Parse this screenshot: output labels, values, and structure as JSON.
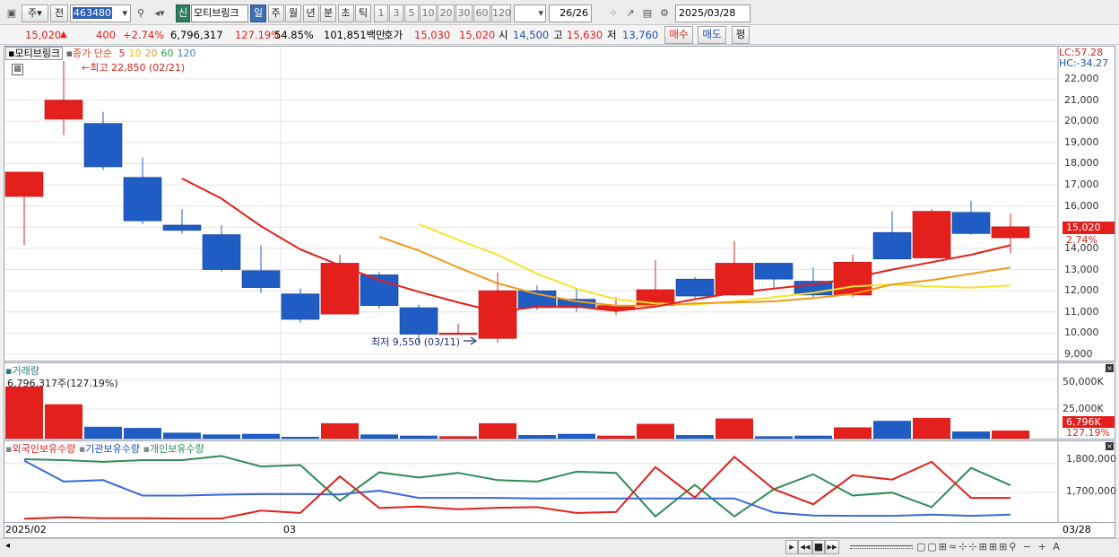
{
  "toolbar": {
    "type_label": "주",
    "prev_label": "전",
    "code": "463480",
    "stock_flag": "신",
    "stock_name": "모티브링크",
    "periods": [
      "일",
      "주",
      "월",
      "년",
      "분",
      "초",
      "틱"
    ],
    "active_period": "일",
    "intervals": [
      "1",
      "3",
      "5",
      "10",
      "20",
      "30",
      "60",
      "120"
    ],
    "count": "26/26",
    "date": "2025/03/28"
  },
  "quote": {
    "price": "15,020",
    "arrow": "▲",
    "change": "400",
    "change_pct": "+2.74%",
    "volume": "6,796,317",
    "volume_pct": "127.19%",
    "turnover_rate": "54.85%",
    "amount": "101,851백만",
    "bid_label": "호가",
    "bid1": "15,030",
    "bid2": "15,020",
    "open_label": "시",
    "open": "14,500",
    "high_label": "고",
    "high": "15,630",
    "low_label": "저",
    "low": "13,760",
    "buy_label": "매수",
    "sell_label": "매도",
    "eval_label": "평"
  },
  "price_panel": {
    "legend_name": "모티브링크",
    "legend_ma_label": "종가 단순",
    "ma_periods": [
      {
        "label": "5",
        "color": "#e3201b"
      },
      {
        "label": "10",
        "color": "#ffbf00"
      },
      {
        "label": "20",
        "color": "#f09a1a"
      },
      {
        "label": "60",
        "color": "#2ea043"
      },
      {
        "label": "120",
        "color": "#3b78d8"
      }
    ],
    "max_note": "←최고 22,850 (02/21)",
    "min_note": "최저 9,550 (03/11)",
    "lc": "LC:57.28",
    "hc": "HC:-34.27",
    "y_ticks": [
      "22,000",
      "21,000",
      "20,000",
      "19,000",
      "18,000",
      "17,000",
      "16,000",
      "15,000",
      "14,000",
      "13,000",
      "12,000",
      "11,000",
      "10,000",
      "9,000"
    ],
    "last_price": "15,020",
    "last_pct": "2.74%"
  },
  "volume_panel": {
    "title": "거래량",
    "value": "6,796,317주(127.19%)",
    "y_ticks": [
      "50,000K",
      "25,000K"
    ],
    "last_value": "6,796K",
    "last_pct": "127.19%"
  },
  "holding_panel": {
    "foreign_label": "외국인보유수량",
    "inst_label": "기관보유수량",
    "indiv_label": "개인보유수량",
    "y_ticks": [
      "1,800,000",
      "1,700,000"
    ]
  },
  "x_axis": {
    "start": "2025/02",
    "mid": "03",
    "end": "03/28"
  },
  "chart_data": {
    "type": "candlestick",
    "candles": [
      {
        "o": 16450,
        "h": 17600,
        "l": 14150,
        "c": 17600
      },
      {
        "o": 20100,
        "h": 22850,
        "l": 19350,
        "c": 21000
      },
      {
        "o": 19900,
        "h": 20450,
        "l": 17700,
        "c": 17850
      },
      {
        "o": 17350,
        "h": 18300,
        "l": 15150,
        "c": 15300
      },
      {
        "o": 15100,
        "h": 15850,
        "l": 14700,
        "c": 14850
      },
      {
        "o": 14650,
        "h": 15100,
        "l": 12900,
        "c": 13000
      },
      {
        "o": 12950,
        "h": 14150,
        "l": 11900,
        "c": 12150
      },
      {
        "o": 11850,
        "h": 12100,
        "l": 10500,
        "c": 10650
      },
      {
        "o": 10900,
        "h": 13700,
        "l": 10900,
        "c": 13300
      },
      {
        "o": 12750,
        "h": 12900,
        "l": 11150,
        "c": 11300
      },
      {
        "o": 11200,
        "h": 11350,
        "l": 9550,
        "c": 9950
      },
      {
        "o": 9950,
        "h": 10450,
        "l": 9950,
        "c": 10000
      },
      {
        "o": 9750,
        "h": 12850,
        "l": 9550,
        "c": 12000
      },
      {
        "o": 12000,
        "h": 12250,
        "l": 11100,
        "c": 11200
      },
      {
        "o": 11600,
        "h": 12100,
        "l": 11000,
        "c": 11200
      },
      {
        "o": 11100,
        "h": 11700,
        "l": 10850,
        "c": 11300
      },
      {
        "o": 11300,
        "h": 13450,
        "l": 11200,
        "c": 12050
      },
      {
        "o": 12550,
        "h": 12650,
        "l": 11650,
        "c": 11750
      },
      {
        "o": 11800,
        "h": 14350,
        "l": 11750,
        "c": 13300
      },
      {
        "o": 13300,
        "h": 13300,
        "l": 12150,
        "c": 12550
      },
      {
        "o": 12450,
        "h": 13100,
        "l": 11700,
        "c": 11800
      },
      {
        "o": 11800,
        "h": 13700,
        "l": 11700,
        "c": 13350
      },
      {
        "o": 14750,
        "h": 15750,
        "l": 13500,
        "c": 13500
      },
      {
        "o": 13550,
        "h": 15850,
        "l": 13550,
        "c": 15750
      },
      {
        "o": 15700,
        "h": 16250,
        "l": 14650,
        "c": 14700
      },
      {
        "o": 14500,
        "h": 15630,
        "l": 13760,
        "c": 15020
      }
    ],
    "ma5": [
      null,
      null,
      null,
      null,
      17300,
      16350,
      15050,
      13950,
      13200,
      12500,
      11950,
      11450,
      11000,
      11250,
      11250,
      11050,
      11250,
      11600,
      11900,
      12100,
      12300,
      12600,
      13000,
      13350,
      13700,
      14150
    ],
    "ma10": [
      null,
      null,
      null,
      null,
      null,
      null,
      null,
      null,
      null,
      null,
      15150,
      14400,
      13700,
      12800,
      12100,
      11600,
      11400,
      11350,
      11500,
      11700,
      11900,
      12200,
      12300,
      12200,
      12150,
      12250
    ],
    "ma20": [
      null,
      null,
      null,
      null,
      null,
      null,
      null,
      null,
      null,
      14550,
      13900,
      13100,
      12350,
      11850,
      11500,
      11300,
      11300,
      11400,
      11450,
      11500,
      11650,
      11850,
      12300,
      12500,
      12800,
      13100
    ],
    "volume": [
      44000,
      29000,
      10000,
      9000,
      5000,
      3500,
      4000,
      1500,
      13000,
      3500,
      2500,
      2000,
      13000,
      3000,
      4000,
      2500,
      12500,
      3000,
      17000,
      2000,
      2500,
      9500,
      15000,
      17500,
      6000,
      6800
    ],
    "volume_up": [
      true,
      true,
      false,
      false,
      false,
      false,
      false,
      false,
      true,
      false,
      false,
      true,
      true,
      false,
      false,
      true,
      true,
      false,
      true,
      false,
      false,
      true,
      false,
      true,
      false,
      true
    ],
    "foreign": [
      1810000,
      1738000,
      1743000,
      1690000,
      1690000,
      1693000,
      1695000,
      1695000,
      1694000,
      1707000,
      1682000,
      1682000,
      1682000,
      1680000,
      1680000,
      1680000,
      1680000,
      1680000,
      1680000,
      1632000,
      1621000,
      1620000,
      1620000,
      1624000,
      1620000,
      1624000
    ],
    "inst": [
      1610000,
      1615000,
      1612000,
      1612000,
      1611000,
      1611000,
      1638000,
      1630000,
      1756000,
      1647000,
      1652000,
      1643000,
      1648000,
      1650000,
      1630000,
      1633000,
      1788000,
      1683000,
      1823000,
      1712000,
      1660000,
      1760000,
      1745000,
      1806000,
      1682000,
      1682000
    ],
    "indiv": [
      1815000,
      1812000,
      1806000,
      1812000,
      1812000,
      1826000,
      1790000,
      1795000,
      1672000,
      1770000,
      1752000,
      1768000,
      1743000,
      1738000,
      1772000,
      1768000,
      1618000,
      1727000,
      1618000,
      1712000,
      1763000,
      1690000,
      1700000,
      1650000,
      1785000,
      1725000
    ]
  }
}
